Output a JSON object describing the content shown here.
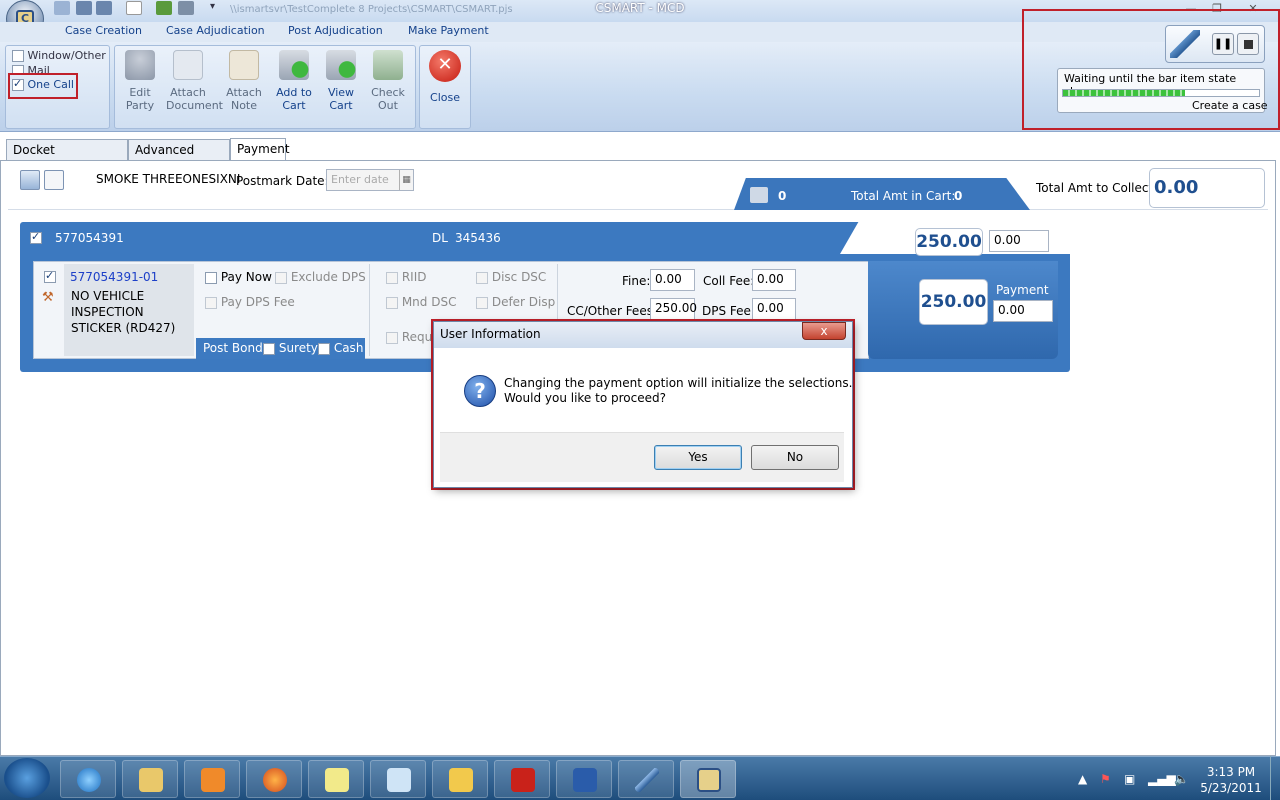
{
  "app": {
    "title": "CSMART - MCD",
    "blurred_path": "\\\\ismartsvr\\TestComplete 8 Projects\\CSMART\\CSMART.pjs"
  },
  "menu": {
    "items": [
      "Case Creation",
      "Case Adjudication",
      "Post Adjudication",
      "Make Payment"
    ]
  },
  "ribbon": {
    "options": [
      {
        "label": "Window/Other",
        "checked": false
      },
      {
        "label": "Mail",
        "checked": false
      },
      {
        "label": "One Call",
        "checked": true
      }
    ],
    "buttons": [
      {
        "line1": "Edit",
        "line2": "Party"
      },
      {
        "line1": "Attach",
        "line2": "Document"
      },
      {
        "line1": "Attach",
        "line2": "Note"
      },
      {
        "line1": "Add to",
        "line2": "Cart"
      },
      {
        "line1": "View",
        "line2": "Cart"
      },
      {
        "line1": "Check",
        "line2": "Out"
      }
    ],
    "close_label": "Close"
  },
  "window_controls": {
    "minimize": "—",
    "restore": "❐",
    "close": "✕"
  },
  "automation": {
    "status": "Waiting until the bar item state changes.",
    "step": "Create a case",
    "progress": 0.62
  },
  "tabs": [
    "Docket Management",
    "Advanced Search",
    "Payment"
  ],
  "payment": {
    "name": "SMOKE THREEONESIXNI",
    "postmark_label": "Postmark Date:",
    "postmark_placeholder": "Enter date",
    "cart_count": "0",
    "total_in_cart_label": "Total Amt in Cart:",
    "total_in_cart": "0",
    "total_to_collect_label": "Total Amt to Collect:",
    "total_to_collect": "0.00",
    "case": {
      "number": "577054391",
      "dl_label": "DL",
      "dl": "345436",
      "total": "250.00",
      "paid": "0.00"
    },
    "citation": {
      "number": "577054391-01",
      "description": "NO VEHICLE INSPECTION STICKER (RD427)",
      "pay_now": "Pay Now",
      "exclude_dps": "Exclude DPS",
      "pay_dps_fee": "Pay DPS Fee",
      "riid": "RIID",
      "disc_dsc": "Disc DSC",
      "mnd_dsc": "Mnd DSC",
      "defer_disp": "Defer Disp",
      "req": "Requ",
      "post_bond_label": "Post Bond:",
      "surety": "Surety",
      "cash": "Cash",
      "fine_label": "Fine:",
      "fine": "0.00",
      "coll_fee_label": "Coll Fee:",
      "coll_fee": "0.00",
      "cc_label": "CC/Other Fees:",
      "cc": "250.00",
      "dps_fee_label": "DPS Fee:",
      "dps_fee": "0.00",
      "amount": "250.00",
      "payment_label": "Payment",
      "payment": "0.00"
    }
  },
  "dialog": {
    "title": "User Information",
    "line1": "Changing the payment option will initialize the selections.",
    "line2": "Would you like to proceed?",
    "yes": "Yes",
    "no": "No",
    "close": "x"
  },
  "taskbar": {
    "time": "3:13 PM",
    "date": "5/23/2011"
  }
}
